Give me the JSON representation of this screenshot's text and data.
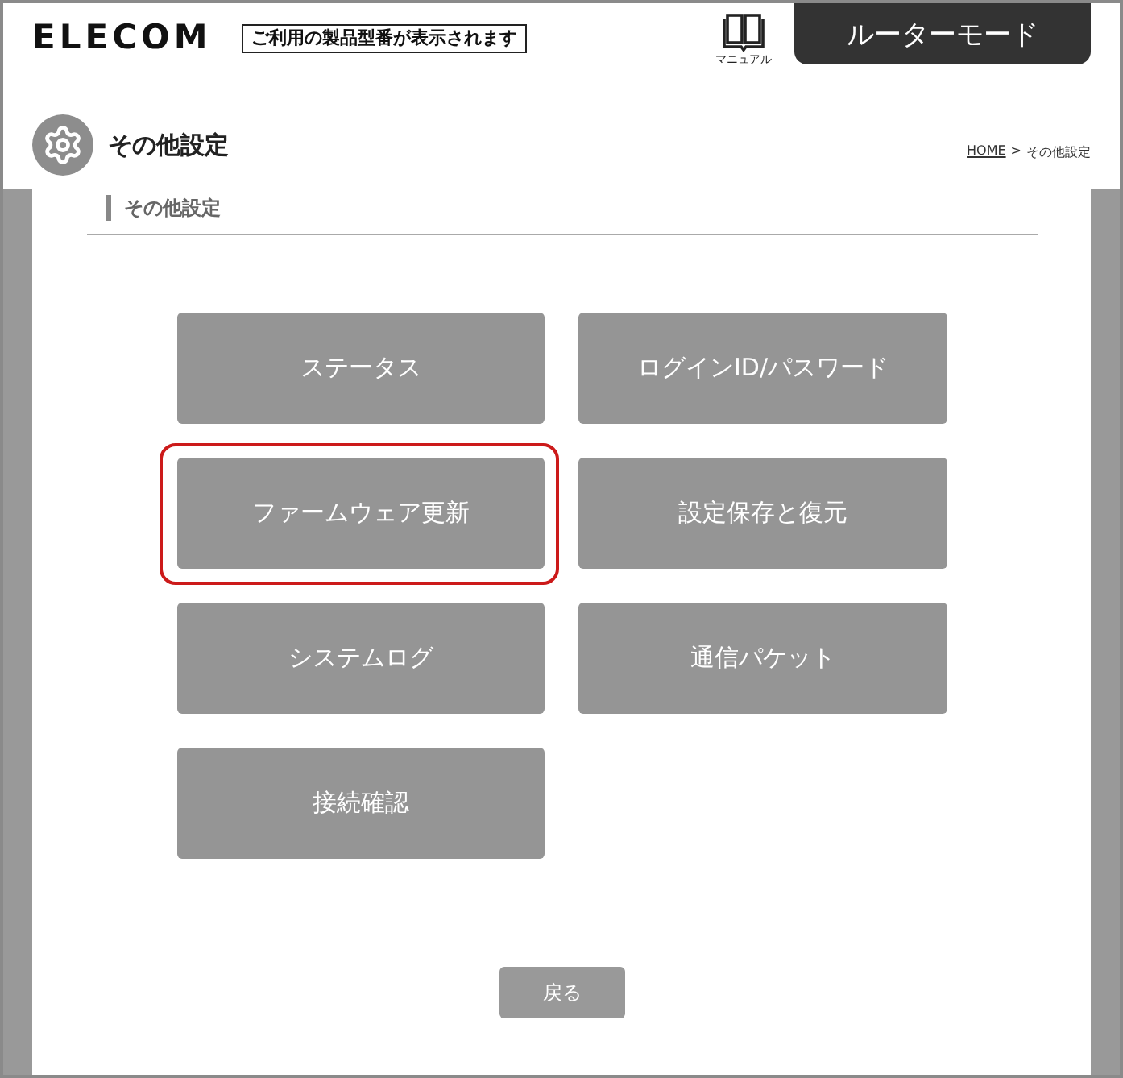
{
  "header": {
    "logo": "ELECOM",
    "model_label": "ご利用の製品型番が表示されます",
    "manual_link": "マニュアル",
    "mode_tab": "ルーターモード"
  },
  "page": {
    "title": "その他設定",
    "breadcrumb": [
      {
        "text": "HOME",
        "kind": "link"
      },
      {
        "text": ">",
        "kind": "separator"
      },
      {
        "text": "その他設定",
        "kind": "current"
      }
    ]
  },
  "section": {
    "heading": "その他設定"
  },
  "menu_buttons": [
    {
      "label": "ステータス",
      "highlighted": false
    },
    {
      "label": "ログインID/パスワード",
      "highlighted": false
    },
    {
      "label": "ファームウェア更新",
      "highlighted": true
    },
    {
      "label": "設定保存と復元",
      "highlighted": false
    },
    {
      "label": "システムログ",
      "highlighted": false
    },
    {
      "label": "通信パケット",
      "highlighted": false
    },
    {
      "label": "接続確認",
      "highlighted": false
    }
  ],
  "back_button": "戻る"
}
